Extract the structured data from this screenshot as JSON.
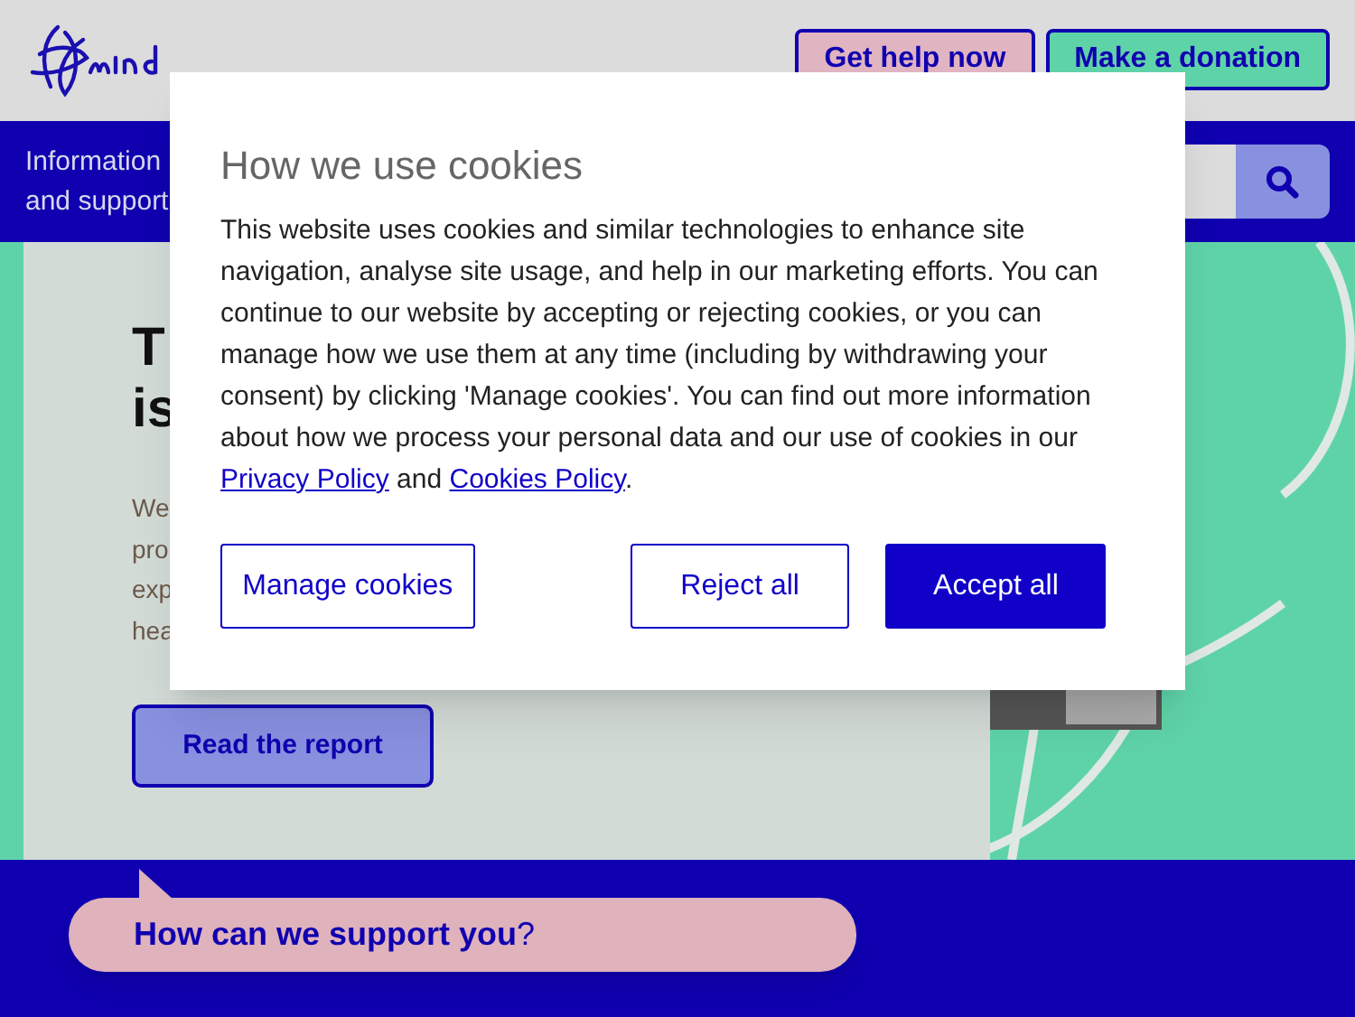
{
  "header": {
    "buttons": [
      {
        "label": "Get help now",
        "kind": "help"
      },
      {
        "label": "Make a donation",
        "kind": "donate"
      }
    ]
  },
  "nav": {
    "menu_label": [
      "Information",
      "and support"
    ]
  },
  "hero": {
    "heading": [
      "T",
      "is"
    ],
    "paragraph": [
      "We",
      "pro",
      "exp",
      "hea"
    ],
    "button": "Read the report"
  },
  "cookie_dialog": {
    "title": "How we use cookies",
    "body": "This website uses cookies and similar technologies to enhance site navigation, analyse site usage, and help in our marketing efforts. You can continue to our website by accepting or rejecting cookies, or you can manage how we use them at any time (including by withdrawing your consent) by clicking 'Manage cookies'. You can find out more information about how we process your personal data and our use of cookies in our ",
    "links": [
      "Privacy Policy",
      "Cookies Policy"
    ],
    "link_joiner": " and ",
    "end": ".",
    "buttons": [
      {
        "label": "Manage cookies",
        "kind": "outline"
      },
      {
        "label": "Reject all",
        "kind": "outline"
      },
      {
        "label": "Accept all",
        "kind": "primary"
      }
    ]
  },
  "support_bubble": {
    "text": "**How can we support you**?"
  }
}
